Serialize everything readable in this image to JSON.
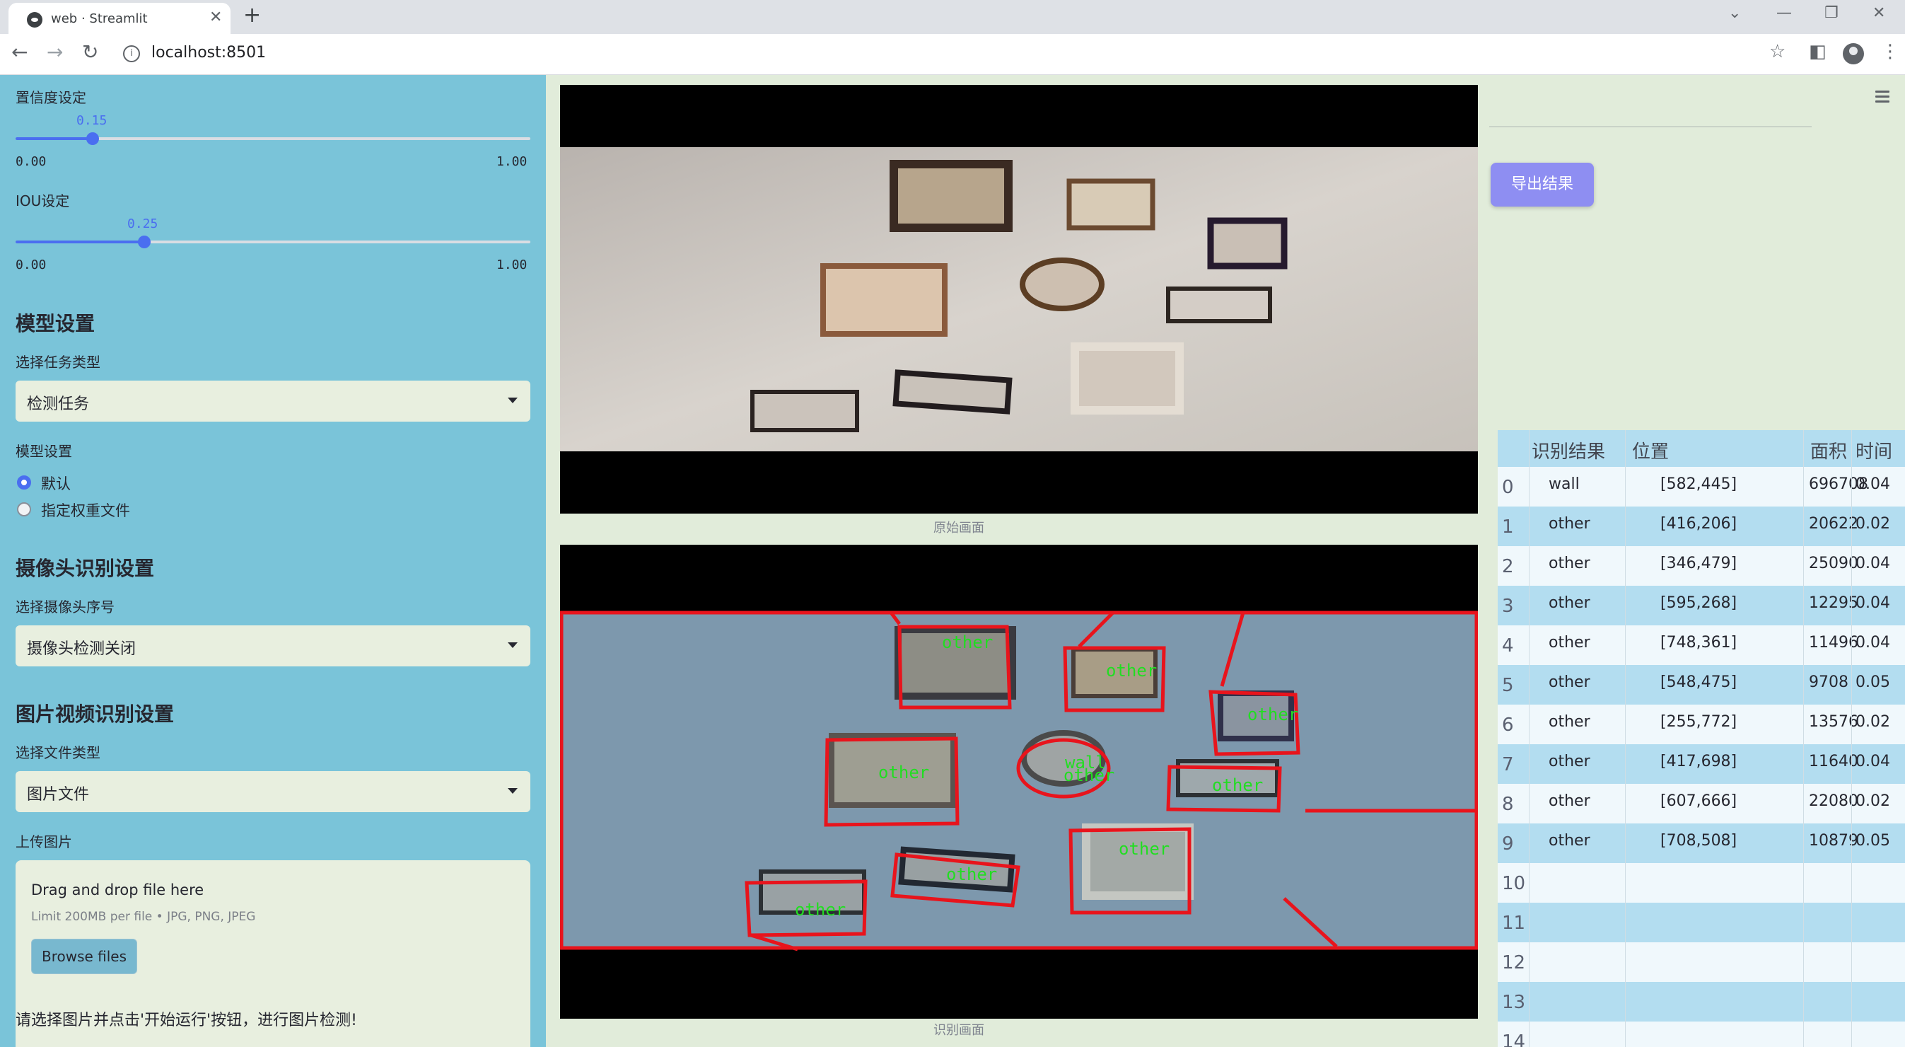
{
  "browser": {
    "tab_title": "web · Streamlit",
    "url": "localhost:8501",
    "tab_close": "✕",
    "new_tab": "+"
  },
  "sidebar": {
    "confidence": {
      "label": "置信度设定",
      "value_text": "0.15",
      "value": 0.15,
      "min": "0.00",
      "max": "1.00"
    },
    "iou": {
      "label": "IOU设定",
      "value_text": "0.25",
      "value": 0.25,
      "min": "0.00",
      "max": "1.00"
    },
    "model_section": {
      "title": "模型设置",
      "task_label": "选择任务类型",
      "task_value": "检测任务",
      "model_label": "模型设置",
      "options": [
        {
          "label": "默认",
          "selected": true
        },
        {
          "label": "指定权重文件",
          "selected": false
        }
      ]
    },
    "camera_section": {
      "title": "摄像头识别设置",
      "camera_label": "选择摄像头序号",
      "camera_value": "摄像头检测关闭"
    },
    "file_section": {
      "title": "图片视频识别设置",
      "type_label": "选择文件类型",
      "type_value": "图片文件",
      "upload_label": "上传图片",
      "drop_text": "Drag and drop file here",
      "limit_text": "Limit 200MB per file • JPG, PNG, JPEG",
      "browse_label": "Browse files"
    },
    "footer_text": "请选择图片并点击'开始运行'按钮，进行图片检测!"
  },
  "main": {
    "original_caption": "原始画面",
    "result_caption": "识别画面",
    "export_label": "导出结果",
    "detections": [
      {
        "label": "other",
        "bbox_note": "frame"
      },
      {
        "label": "wall",
        "bbox_note": "wall"
      }
    ],
    "detection_label_other": "other",
    "detection_label_wall": "wall"
  },
  "table": {
    "headers": [
      "识别结果",
      "位置",
      "面积",
      "时间"
    ],
    "rows": [
      {
        "idx": "0",
        "result": "wall",
        "pos": "[582,445]",
        "area": "696708",
        "time": "0.04"
      },
      {
        "idx": "1",
        "result": "other",
        "pos": "[416,206]",
        "area": "20622",
        "time": "0.02"
      },
      {
        "idx": "2",
        "result": "other",
        "pos": "[346,479]",
        "area": "25090",
        "time": "0.04"
      },
      {
        "idx": "3",
        "result": "other",
        "pos": "[595,268]",
        "area": "12295",
        "time": "0.04"
      },
      {
        "idx": "4",
        "result": "other",
        "pos": "[748,361]",
        "area": "11496",
        "time": "0.04"
      },
      {
        "idx": "5",
        "result": "other",
        "pos": "[548,475]",
        "area": "9708",
        "time": "0.05"
      },
      {
        "idx": "6",
        "result": "other",
        "pos": "[255,772]",
        "area": "13576",
        "time": "0.02"
      },
      {
        "idx": "7",
        "result": "other",
        "pos": "[417,698]",
        "area": "11640",
        "time": "0.04"
      },
      {
        "idx": "8",
        "result": "other",
        "pos": "[607,666]",
        "area": "22080",
        "time": "0.02"
      },
      {
        "idx": "9",
        "result": "other",
        "pos": "[708,508]",
        "area": "10879",
        "time": "0.05"
      },
      {
        "idx": "10",
        "result": "",
        "pos": "",
        "area": "",
        "time": ""
      },
      {
        "idx": "11",
        "result": "",
        "pos": "",
        "area": "",
        "time": ""
      },
      {
        "idx": "12",
        "result": "",
        "pos": "",
        "area": "",
        "time": ""
      },
      {
        "idx": "13",
        "result": "",
        "pos": "",
        "area": "",
        "time": ""
      },
      {
        "idx": "14",
        "result": "",
        "pos": "",
        "area": "",
        "time": ""
      }
    ]
  },
  "colors": {
    "sidebar_bg": "#7ac4d9",
    "main_bg": "#e1ecda",
    "accent": "#4a6ef0",
    "export_button": "#8e8ef2",
    "detection_box": "#e8141c",
    "detection_text": "#22dd22"
  }
}
